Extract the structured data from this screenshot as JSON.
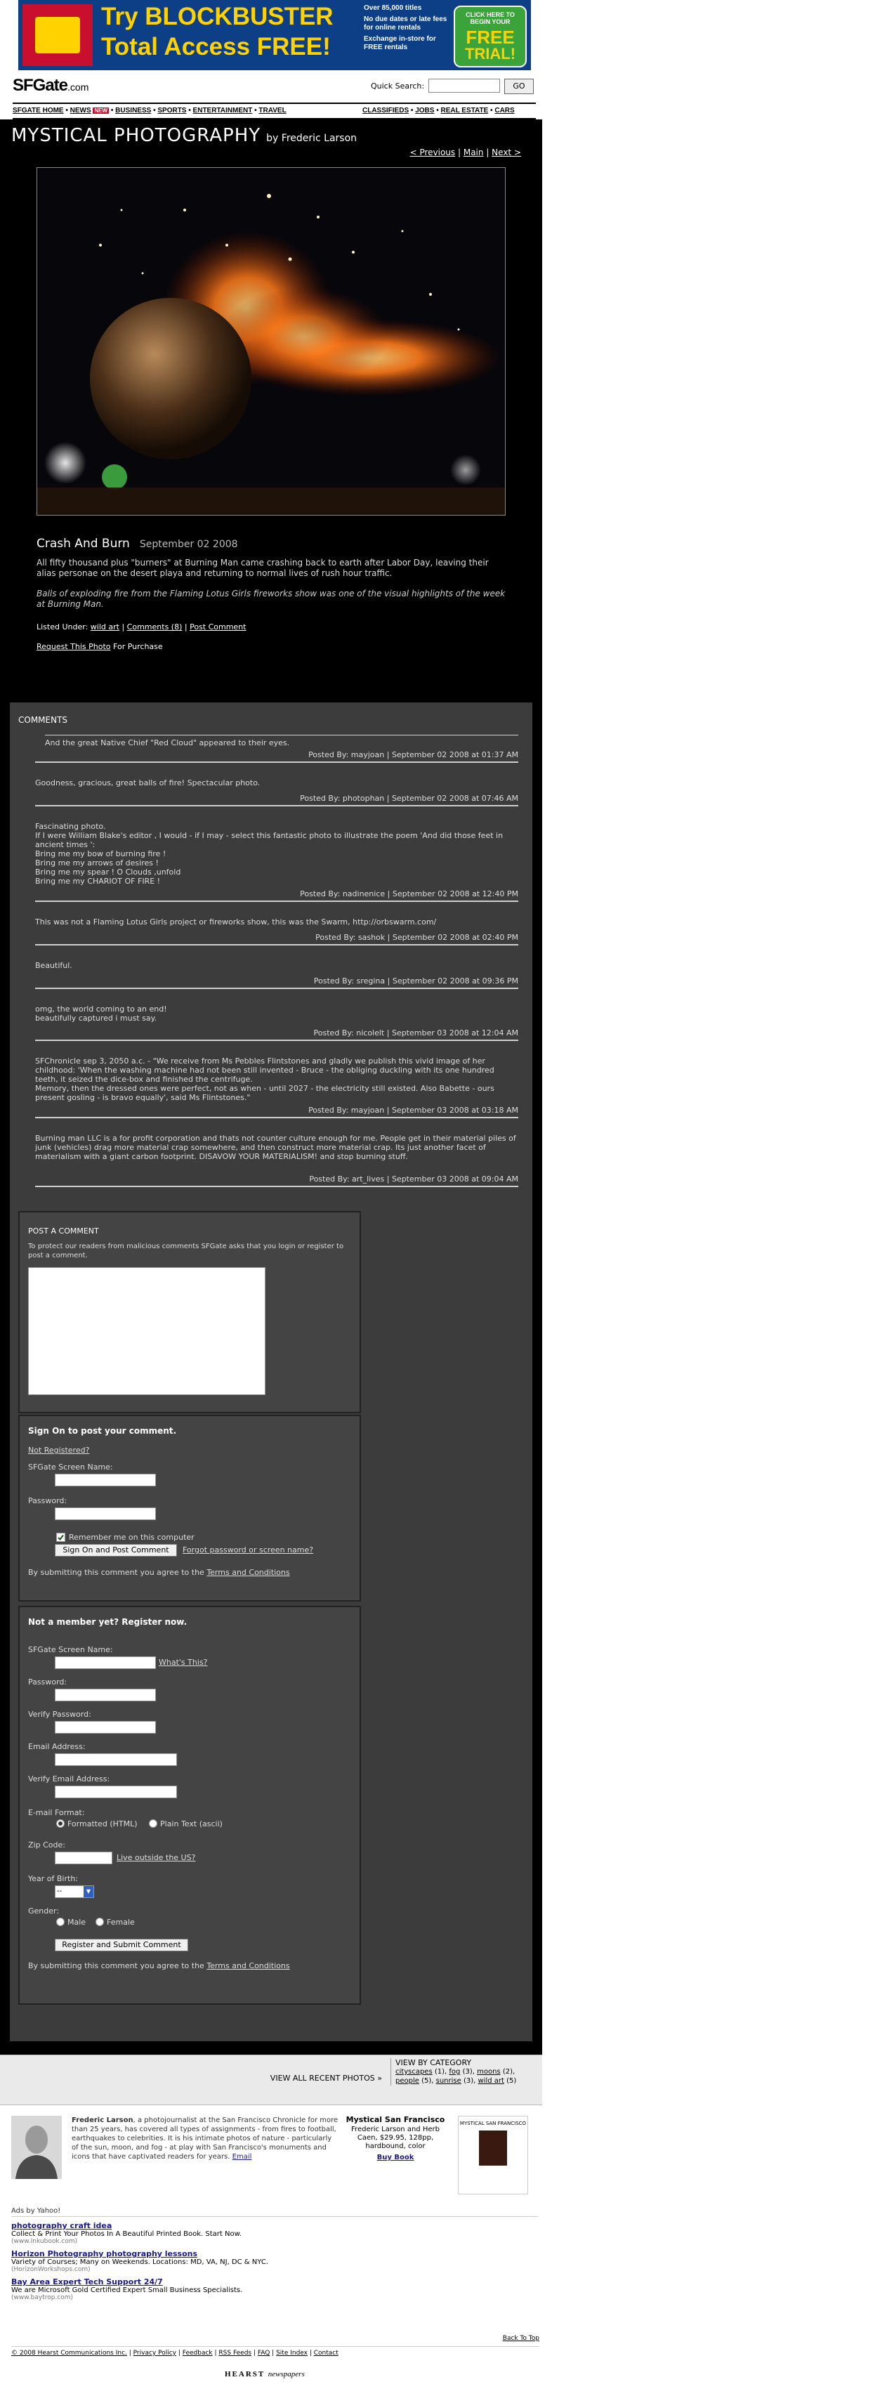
{
  "banner": {
    "line1": "Try BLOCKBUSTER",
    "line2": "Total Access FREE!",
    "bullets": [
      "Over 85,000 titles",
      "No due dates or late fees for online rentals",
      "Exchange in-store for FREE rentals"
    ],
    "cta_small": "CLICK HERE TO BEGIN YOUR",
    "cta_big1": "FREE",
    "cta_big2": "TRIAL!"
  },
  "header": {
    "logo": "SFGate",
    "logo_suffix": ".com",
    "quick_search_label": "Quick Search:",
    "go_label": "GO"
  },
  "nav": {
    "left": [
      "SFGATE HOME",
      "NEWS",
      "BUSINESS",
      "SPORTS",
      "ENTERTAINMENT",
      "TRAVEL"
    ],
    "right": [
      "CLASSIFIEDS",
      "JOBS",
      "REAL ESTATE",
      "CARS"
    ]
  },
  "gallery": {
    "title": "MYSTICAL PHOTOGRAPHY",
    "byline": "by Frederic Larson",
    "prev": "< Previous",
    "main": "Main",
    "next": "Next >"
  },
  "photo": {
    "title": "Crash And Burn",
    "date": "September 02 2008",
    "description": "All fifty thousand plus \"burners\" at Burning Man came crashing back to earth after Labor Day, leaving their alias personae on the desert playa and returning to normal lives of rush hour traffic.",
    "caption": "Balls of exploding fire from the Flaming Lotus Girls fireworks show was one of the visual highlights of the week at Burning Man.",
    "listed_label": "Listed Under:",
    "listed_link": "wild art",
    "comments_link": "Comments (8)",
    "post_link": "Post Comment",
    "request_link": "Request This Photo",
    "request_suffix": "For Purchase"
  },
  "comments_heading": "COMMENTS",
  "comments": [
    {
      "text": "And the great Native Chief \"Red Cloud\" appeared to their eyes.",
      "meta": "Posted By: mayjoan | September 02 2008 at 01:37 AM"
    },
    {
      "text": "Goodness, gracious, great balls of fire! Spectacular photo.",
      "meta": "Posted By: photophan | September 02 2008 at 07:46 AM"
    },
    {
      "text": "Fascinating photo.\nIf I were William Blake's editor , I would - if I may - select this fantastic photo to illustrate the poem 'And did those feet in ancient times ':\nBring me my bow of burning fire !\nBring me my arrows of desires !\nBring me my spear ! O Clouds ,unfold\nBring me my CHARIOT OF FIRE !",
      "meta": "Posted By: nadinenice | September 02 2008 at 12:40 PM"
    },
    {
      "text": "This was not a Flaming Lotus Girls project or fireworks show, this was the Swarm, http://orbswarm.com/",
      "meta": "Posted By: sashok | September 02 2008 at 02:40 PM"
    },
    {
      "text": "Beautiful.",
      "meta": "Posted By: sregina | September 02 2008 at 09:36 PM"
    },
    {
      "text": "omg, the world coming to an end!\nbeautifully captured i must say.",
      "meta": "Posted By: nicolelt | September 03 2008 at 12:04 AM"
    },
    {
      "text": "SFChronicle sep 3, 2050 a.c. - \"We receive from Ms Pebbles Flintstones and gladly we publish this vivid image of her childhood: 'When the washing machine had not been still invented - Bruce - the obliging duckling with its one hundred teeth, it seized the dice-box and finished the centrifuge.\nMemory, then the dressed ones were perfect, not as when - until 2027 - the electricity still existed. Also Babette - ours present gosling - is bravo equally', said Ms Flintstones.\"",
      "meta": "Posted By: mayjoan | September 03 2008 at 03:18 AM"
    },
    {
      "text": "Burning man LLC is a for profit corporation and thats not counter culture enough for me. People get in their material piles of junk (vehicles) drag more material crap somewhere, and then construct more material crap. Its just another facet of materialism with a giant carbon footprint. DISAVOW YOUR MATERIALISM! and stop burning stuff.",
      "meta": "Posted By: art_lives | September 03 2008 at 09:04 AM"
    }
  ],
  "post_form": {
    "heading": "POST A COMMENT",
    "note": "To protect our readers from malicious comments SFGate asks that you login or register to post a comment."
  },
  "signon": {
    "heading": "Sign On to post your comment.",
    "not_registered": "Not Registered?",
    "screen_name_label": "SFGate Screen Name:",
    "password_label": "Password:",
    "remember_label": "Remember me on this computer",
    "submit_label": "Sign On and Post Comment",
    "forgot_link": "Forgot password or screen name?",
    "terms_prefix": "By submitting this comment you agree to the",
    "terms_link": "Terms and Conditions"
  },
  "register": {
    "heading": "Not a member yet? Register now.",
    "screen_name_label": "SFGate Screen Name:",
    "whats_this": "What's This?",
    "password_label": "Password:",
    "verify_password_label": "Verify Password:",
    "email_label": "Email Address:",
    "verify_email_label": "Verify Email Address:",
    "email_format_label": "E-mail Format:",
    "format_html": "Formatted (HTML)",
    "format_plain": "Plain Text (ascii)",
    "zip_label": "Zip Code:",
    "outside_us": "Live outside the US?",
    "year_label": "Year of Birth:",
    "year_value": "--",
    "gender_label": "Gender:",
    "male": "Male",
    "female": "Female",
    "submit_label": "Register and Submit Comment",
    "terms_prefix": "By submitting this comment you agree to the",
    "terms_link": "Terms and Conditions"
  },
  "bottom_bar": {
    "view_all": "VIEW ALL RECENT PHOTOS »",
    "category_heading": "VIEW BY CATEGORY",
    "categories": [
      {
        "name": "cityscapes",
        "count": "(1)"
      },
      {
        "name": "fog",
        "count": "(3)"
      },
      {
        "name": "moons",
        "count": "(2)"
      },
      {
        "name": "people",
        "count": "(5)"
      },
      {
        "name": "sunrise",
        "count": "(3)"
      },
      {
        "name": "wild art",
        "count": "(5)"
      }
    ]
  },
  "author": {
    "name": "Frederic Larson",
    "bio": ", a photojournalist at the San Francisco Chronicle for more than 25 years, has covered all types of assignments - from fires to football, earthquakes to celebrities. It is his intimate photos of nature - particularly of the sun, moon, and fog - at play with San Francisco's monuments and icons that have captivated readers for years.",
    "email_link": "Email"
  },
  "book": {
    "title": "Mystical San Francisco",
    "details": "Frederic Larson and Herb Caen, $29.95, 128pp, hardbound, color",
    "buy_link": "Buy Book",
    "cover_title": "MYSTICAL SAN FRANCISCO"
  },
  "ads": {
    "heading": "Ads by Yahoo!",
    "items": [
      {
        "title": "photography craft idea",
        "text": "Collect & Print Your Photos In A Beautiful Printed Book. Start Now.",
        "url": "(www.Inkubook.com)"
      },
      {
        "title": "Horizon Photography photography lessons",
        "text": "Variety of Courses; Many on Weekends. Locations: MD, VA, NJ, DC & NYC.",
        "url": "(HorizonWorkshops.com)"
      },
      {
        "title": "Bay Area Expert Tech Support 24/7",
        "text": "We are Microsoft Gold Certified Expert Small Business Specialists.",
        "url": "(www.baytrop.com)"
      }
    ]
  },
  "footer": {
    "back_to_top": "Back To Top",
    "copyright": "© 2008 Hearst Communications Inc.",
    "links": [
      "Privacy Policy",
      "Feedback",
      "RSS Feeds",
      "FAQ",
      "Site Index",
      "Contact"
    ],
    "hearst": "HEARST",
    "newspapers": "newspapers"
  }
}
